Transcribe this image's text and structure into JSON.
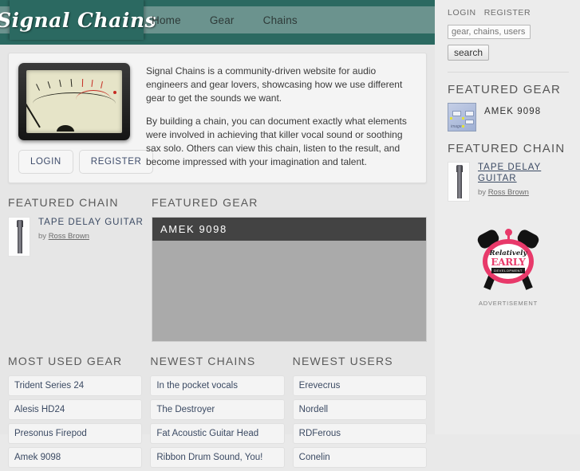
{
  "site": {
    "logo_text": "Signal Chains"
  },
  "nav": {
    "items": [
      {
        "label": "Home"
      },
      {
        "label": "Gear"
      },
      {
        "label": "Chains"
      }
    ]
  },
  "account": {
    "login_label": "LOGIN",
    "register_label": "REGISTER"
  },
  "search": {
    "placeholder": "gear, chains, users",
    "value": "",
    "button_label": "search"
  },
  "sidebar": {
    "featured_gear": {
      "heading": "FEATURED GEAR",
      "name": "AMEK 9098",
      "thumb_label": "image"
    },
    "featured_chain": {
      "heading": "FEATURED CHAIN",
      "title": "TAPE DELAY GUITAR",
      "by_prefix": "by ",
      "author": "Ross Brown"
    },
    "advertisement": {
      "label": "ADVERTISEMENT",
      "brand_script": "Relatively",
      "brand_main": "EARLY",
      "brand_sub": "DEVELOPMENT"
    }
  },
  "intro": {
    "paragraphs": [
      "Signal Chains is a community-driven website for audio engineers and gear lovers, showcasing how we use different gear to get the sounds we want.",
      "By building a chain, you can document exactly what elements were involved in achieving that killer vocal sound or soothing sax solo. Others can view this chain, listen to the result, and become impressed with your imagination and talent."
    ],
    "login_label": "LOGIN",
    "register_label": "REGISTER"
  },
  "main": {
    "featured_chain": {
      "heading": "FEATURED CHAIN",
      "title": "TAPE DELAY GUITAR",
      "by_prefix": "by ",
      "author": "Ross Brown"
    },
    "featured_gear": {
      "heading": "FEATURED GEAR",
      "name": "AMEK 9098"
    },
    "lists": [
      {
        "heading": "MOST USED GEAR",
        "items": [
          "Trident Series 24",
          "Alesis HD24",
          "Presonus Firepod",
          "Amek 9098"
        ]
      },
      {
        "heading": "NEWEST CHAINS",
        "items": [
          "In the pocket vocals",
          "The Destroyer",
          "Fat Acoustic Guitar Head",
          "Ribbon Drum Sound, You!"
        ]
      },
      {
        "heading": "NEWEST USERS",
        "items": [
          "Erevecrus",
          "Nordell",
          "RDFerous",
          "Conelin"
        ]
      }
    ]
  },
  "colors": {
    "teal_dark": "#2b6961",
    "teal_light": "#6b938e",
    "panel_dark": "#434343",
    "panel_body": "#aaaaaa",
    "link": "#3b4a63",
    "accent_pink": "#e8396a"
  }
}
